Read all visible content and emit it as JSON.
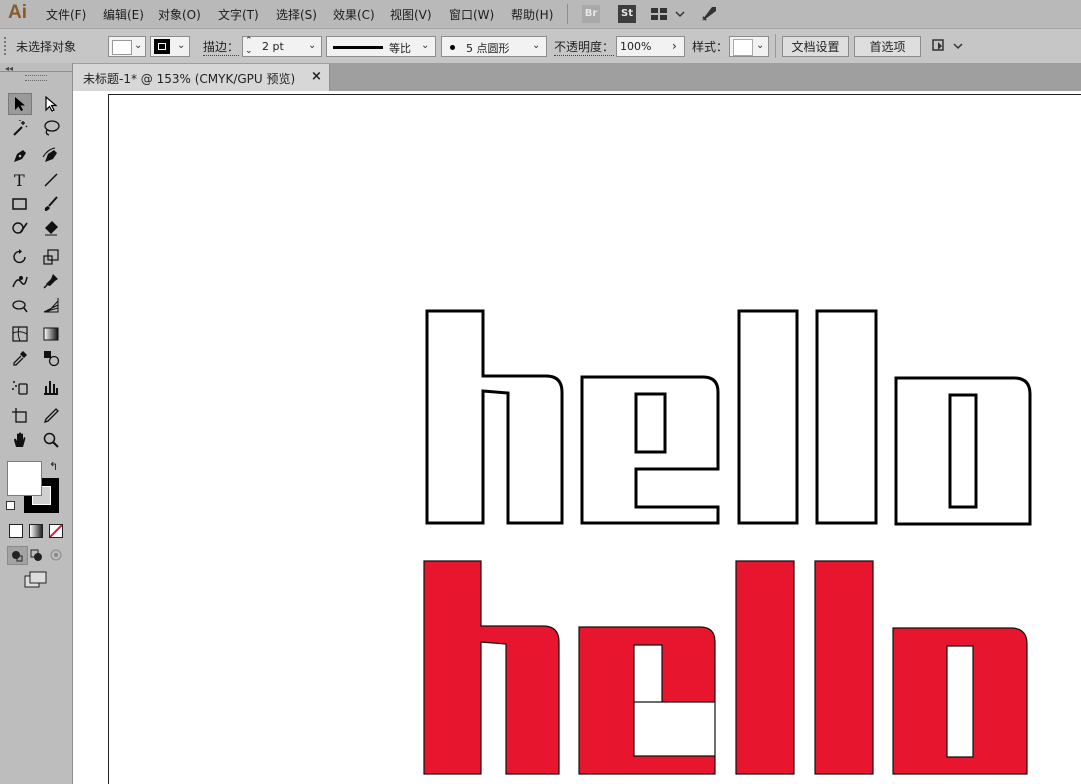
{
  "app": {
    "logo": "Ai"
  },
  "menu": [
    {
      "label": "文件(F)"
    },
    {
      "label": "编辑(E)"
    },
    {
      "label": "对象(O)"
    },
    {
      "label": "文字(T)"
    },
    {
      "label": "选择(S)"
    },
    {
      "label": "效果(C)"
    },
    {
      "label": "视图(V)"
    },
    {
      "label": "窗口(W)"
    },
    {
      "label": "帮助(H)"
    }
  ],
  "bridge_badges": {
    "br": "Br",
    "st": "St"
  },
  "control_bar": {
    "selection_status": "未选择对象",
    "stroke_label": "描边：",
    "stroke_weight": "2 pt",
    "profile_label": "等比",
    "brush_label": "5 点圆形",
    "opacity_label": "不透明度：",
    "opacity_value": "100%",
    "style_label": "样式：",
    "doc_setup_button": "文档设置",
    "preferences_button": "首选项"
  },
  "document_tab": {
    "title": "未标题-1* @ 153% (CMYK/GPU 预览)",
    "close": "×"
  },
  "artwork": {
    "outline_text": "hello",
    "filled_text": "hello",
    "fill_color": "#e8152e",
    "stroke_color": "#000000"
  },
  "colors": {
    "menubar_bg": "#b9b9b9",
    "panel_bg": "#bdbdbd",
    "canvas_bg": "#ffffff",
    "accent_red": "#e8152e"
  },
  "tools": [
    "selection-tool",
    "direct-selection-tool",
    "magic-wand-tool",
    "lasso-tool",
    "pen-tool",
    "curvature-tool",
    "type-tool",
    "line-segment-tool",
    "rectangle-tool",
    "paintbrush-tool",
    "shaper-tool",
    "eraser-tool",
    "rotate-tool",
    "scale-tool",
    "warp-tool",
    "puppet-warp-tool",
    "free-transform-tool",
    "perspective-grid-tool",
    "mesh-tool",
    "gradient-tool",
    "eyedropper-tool",
    "blend-tool",
    "symbol-sprayer-tool",
    "column-graph-tool",
    "artboard-tool",
    "slice-tool",
    "hand-tool",
    "zoom-tool"
  ]
}
